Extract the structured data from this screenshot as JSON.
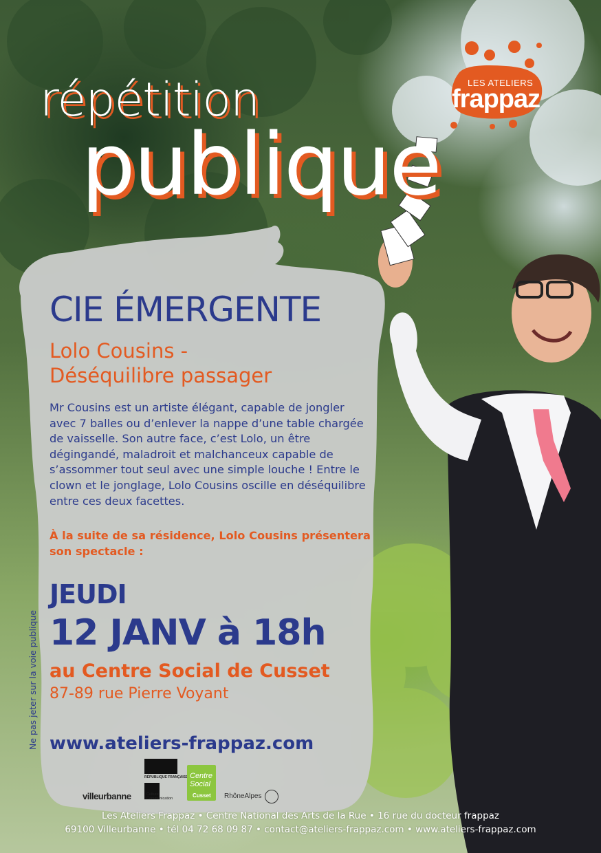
{
  "header": {
    "title_line1": "répétition",
    "title_line2": "publique",
    "logo_small": "LES ATELIERS",
    "logo_big": "frappaz"
  },
  "event": {
    "company": "CIE ÉMERGENTE",
    "show_line1": "Lolo Cousins -",
    "show_line2": "Déséquilibre passager",
    "description": "Mr Cousins est un artiste élégant, capable de jongler avec 7 balles ou d’enlever la nappe d’une table chargée de vaisselle. Son autre face, c’est Lolo, un être dégingandé, maladroit et malchanceux capable de s’assommer tout seul avec une simple louche ! Entre le clown et le jonglage, Lolo Cousins oscille en déséquilibre entre ces deux facettes.",
    "highlight": "À la suite de sa résidence, Lolo Cousins présentera son spectacle :",
    "day": "JEUDI",
    "datetime": "12 JANV à 18h",
    "venue": "au Centre Social de Cusset",
    "address": "87-89 rue Pierre Voyant",
    "website": "www.ateliers-frappaz.com"
  },
  "side_note": "Ne pas jeter sur la voie publique",
  "partners": {
    "villeurbanne": "villeurbanne",
    "republique": "RÉPUBLIQUE FRANÇAISE",
    "culture": "Culture Communication",
    "centre_social": "Centre Social",
    "cusset": "Cusset",
    "rhonealpes": "RhôneAlpes"
  },
  "footer": {
    "line1": "Les Ateliers Frappaz • Centre National des Arts de la Rue • 16 rue du docteur frappaz",
    "line2": "69100 Villeurbanne • tél 04 72 68 09 87 • contact@ateliers-frappaz.com • www.ateliers-frappaz.com"
  },
  "colors": {
    "accent_orange": "#e35a21",
    "navy": "#2b3a8c",
    "panel": "#c9cbc9"
  }
}
